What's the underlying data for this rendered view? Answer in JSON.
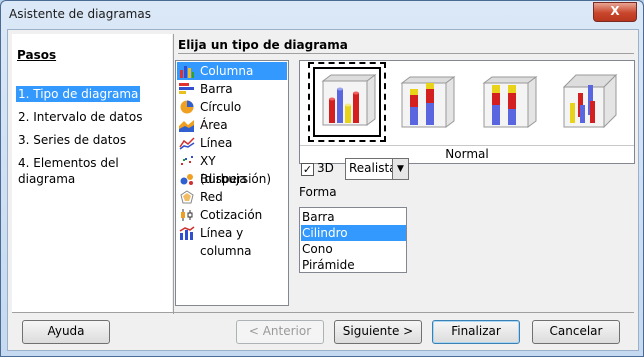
{
  "window": {
    "title": "Asistente de diagramas",
    "close_label": "X"
  },
  "steps": {
    "title": "Pasos",
    "items": [
      {
        "label": "1. Tipo de diagrama",
        "selected": true
      },
      {
        "label": "2. Intervalo de datos",
        "selected": false
      },
      {
        "label": "3. Series de datos",
        "selected": false
      },
      {
        "label": "4. Elementos del diagrama",
        "selected": false
      }
    ]
  },
  "main": {
    "heading": "Elija un tipo de diagrama",
    "chart_types": [
      {
        "label": "Columna",
        "icon": "column-chart-icon",
        "selected": true
      },
      {
        "label": "Barra",
        "icon": "bar-chart-icon"
      },
      {
        "label": "Círculo",
        "icon": "pie-chart-icon"
      },
      {
        "label": "Área",
        "icon": "area-chart-icon"
      },
      {
        "label": "Línea",
        "icon": "line-chart-icon"
      },
      {
        "label": "XY (dispersión)",
        "icon": "scatter-chart-icon"
      },
      {
        "label": "Burbuja",
        "icon": "bubble-chart-icon"
      },
      {
        "label": "Red",
        "icon": "net-chart-icon"
      },
      {
        "label": "Cotización",
        "icon": "stock-chart-icon"
      },
      {
        "label": "Línea y columna",
        "icon": "column-line-chart-icon"
      }
    ],
    "variant_caption": "Normal",
    "three_d": {
      "label": "3D",
      "checked": true,
      "check_glyph": "✓"
    },
    "style_select": {
      "value": "Realista",
      "arrow": "▼"
    },
    "shape": {
      "label": "Forma",
      "options": [
        {
          "label": "Barra",
          "selected": false
        },
        {
          "label": "Cilindro",
          "selected": true
        },
        {
          "label": "Cono",
          "selected": false
        },
        {
          "label": "Pirámide",
          "selected": false
        }
      ]
    }
  },
  "buttons": {
    "help": "Ayuda",
    "back": "< Anterior",
    "next": "Siguiente >",
    "finish": "Finalizar",
    "cancel": "Cancelar"
  },
  "colors": {
    "selection": "#3399ff",
    "cylinder_red": "#d31f1f",
    "cylinder_blue": "#5a66e0",
    "cylinder_yellow": "#e8d21a"
  }
}
